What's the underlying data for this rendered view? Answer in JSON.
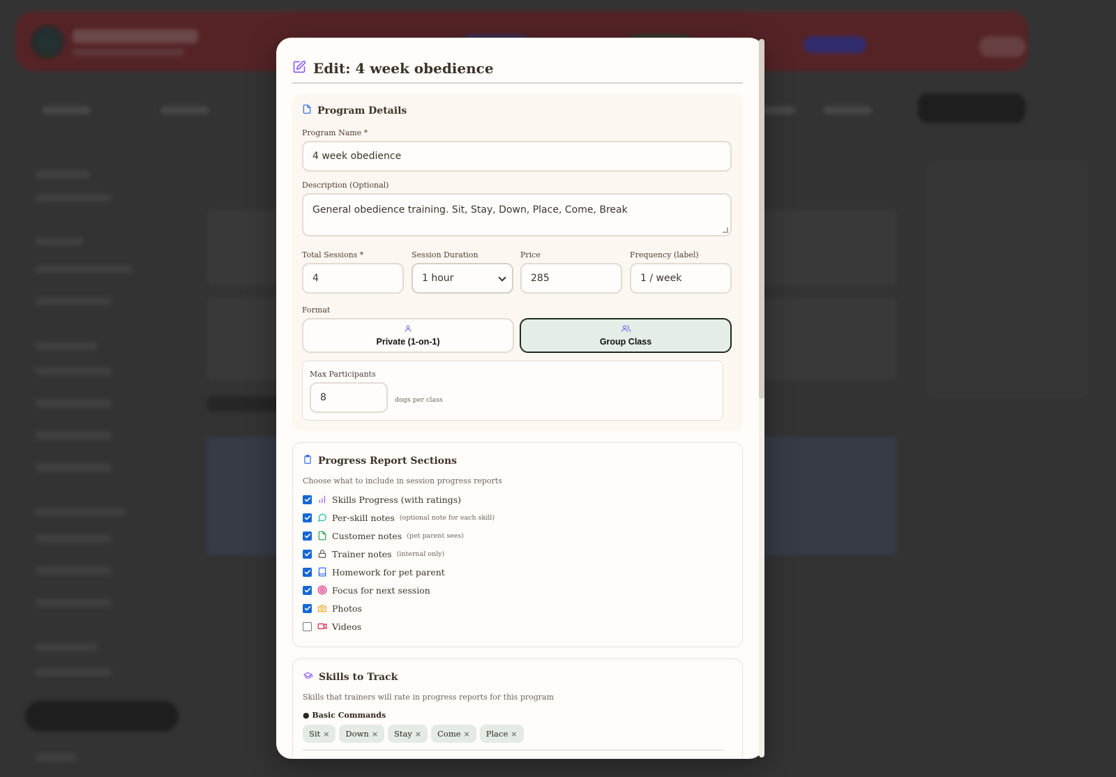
{
  "modal": {
    "title": "Edit: 4 week obedience"
  },
  "details": {
    "heading": "Program Details",
    "name_label": "Program Name *",
    "name_value": "4 week obedience",
    "desc_label": "Description (Optional)",
    "desc_value": "General obedience training.  Sit, Stay, Down, Place, Come, Break",
    "sessions_label": "Total Sessions *",
    "sessions_value": "4",
    "duration_label": "Session Duration",
    "duration_value": "1 hour",
    "price_label": "Price",
    "price_value": "285",
    "frequency_label": "Frequency (label)",
    "frequency_value": "1 / week",
    "format_label": "Format",
    "format_private": "Private (1-on-1)",
    "format_group": "Group Class",
    "format_selected": "Group Class",
    "max_label": "Max Participants",
    "max_value": "8",
    "max_hint": "dogs per class"
  },
  "progress": {
    "heading": "Progress Report Sections",
    "description": "Choose what to include in session progress reports",
    "items": [
      {
        "label": "Skills Progress (with ratings)",
        "sub": "",
        "checked": true,
        "icon": "bar-chart-icon",
        "color": "#8b5cf6"
      },
      {
        "label": "Per-skill notes",
        "sub": "(optional note for each skill)",
        "checked": true,
        "icon": "chat-bubble-icon",
        "color": "#14b8a6"
      },
      {
        "label": "Customer notes",
        "sub": "(pet parent sees)",
        "checked": true,
        "icon": "document-icon",
        "color": "#22a04a"
      },
      {
        "label": "Trainer notes",
        "sub": "(internal only)",
        "checked": true,
        "icon": "lock-icon",
        "color": "#555555"
      },
      {
        "label": "Homework for pet parent",
        "sub": "",
        "checked": true,
        "icon": "book-icon",
        "color": "#2563eb"
      },
      {
        "label": "Focus for next session",
        "sub": "",
        "checked": true,
        "icon": "target-icon",
        "color": "#db2777"
      },
      {
        "label": "Photos",
        "sub": "",
        "checked": true,
        "icon": "camera-icon",
        "color": "#f59e0b"
      },
      {
        "label": "Videos",
        "sub": "",
        "checked": false,
        "icon": "video-icon",
        "color": "#e11d48"
      }
    ]
  },
  "skills": {
    "heading": "Skills to Track",
    "description": "Skills that trainers will rate in progress reports for this program",
    "category": "● Basic Commands",
    "chips": [
      "Sit",
      "Down",
      "Stay",
      "Come",
      "Place"
    ]
  },
  "colors": {
    "accent_purple": "#8b5cf6",
    "accent_blue": "#2563eb",
    "selected_bg": "#e4ede6",
    "checkbox_blue": "#1467d6"
  }
}
